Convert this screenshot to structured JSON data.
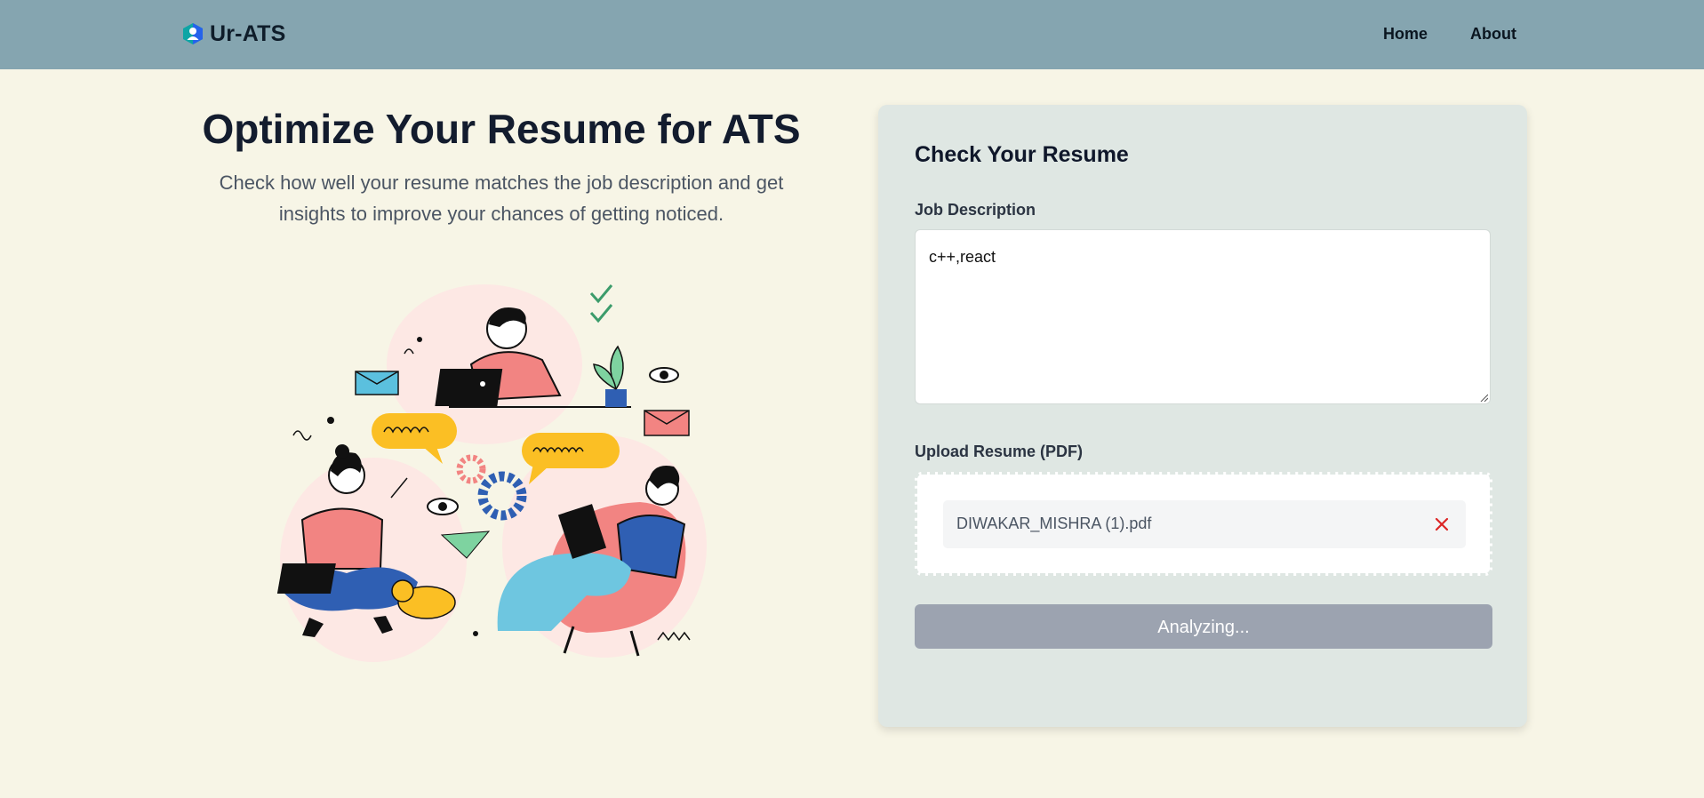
{
  "nav": {
    "brand": "Ur-ATS",
    "links": [
      {
        "label": "Home"
      },
      {
        "label": "About"
      }
    ]
  },
  "hero": {
    "title": "Optimize Your Resume for ATS",
    "subtitle": "Check how well your resume matches the job description and get insights to improve your chances of getting noticed."
  },
  "card": {
    "title": "Check Your Resume",
    "job_description_label": "Job Description",
    "job_description_value": "c++,react",
    "upload_label": "Upload Resume (PDF)",
    "uploaded_file": "DIWAKAR_MISHRA (1).pdf",
    "analyze_button": "Analyzing..."
  },
  "colors": {
    "navbar": "#85a5b0",
    "page_background": "#f7f5e6",
    "card_background": "#dfe7e3",
    "button_disabled": "#9ca3b0",
    "remove_icon": "#dc2626"
  },
  "icons": [
    "ur-ats-logo-icon",
    "close-icon",
    "resize-grip-icon"
  ]
}
